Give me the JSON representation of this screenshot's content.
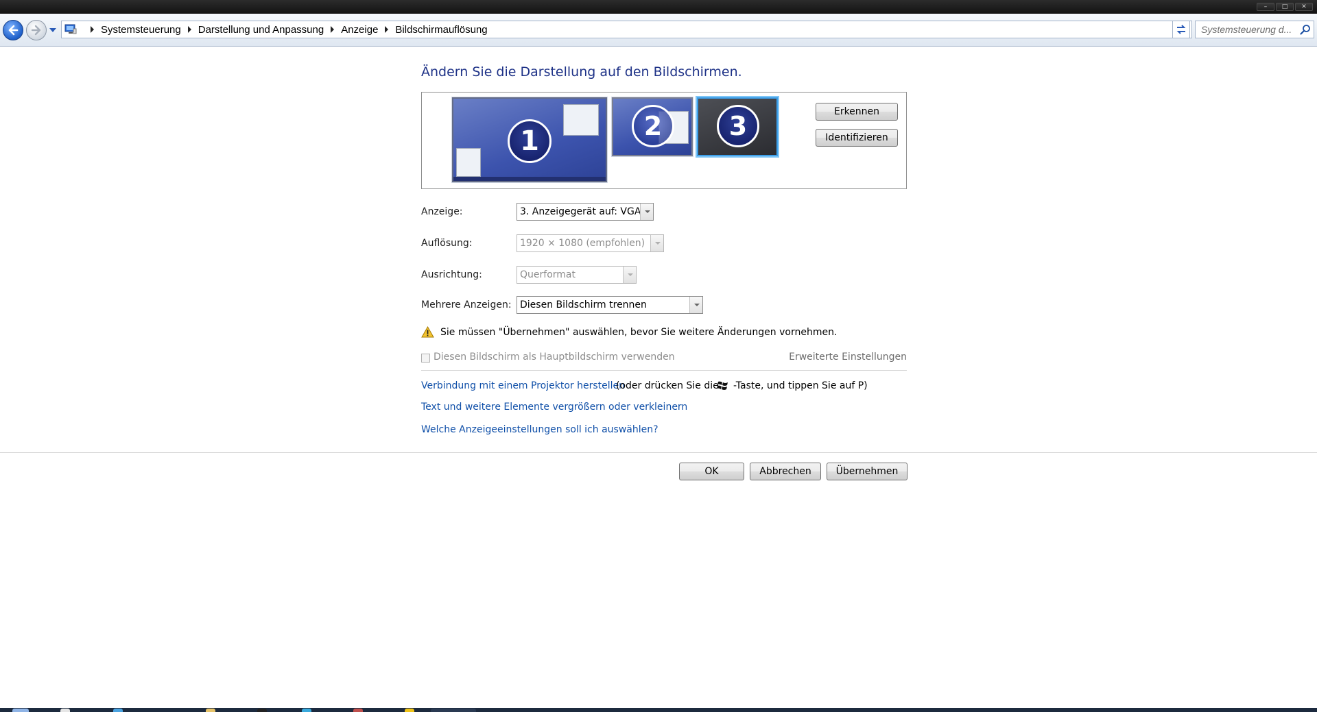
{
  "window": {
    "controls": {
      "minimize": "–",
      "maximize": "□",
      "close": "✕"
    }
  },
  "addressbar": {
    "breadcrumbs": [
      "Systemsteuerung",
      "Darstellung und Anpassung",
      "Anzeige",
      "Bildschirmauflösung"
    ],
    "search_placeholder": "Systemsteuerung d...",
    "icons": [
      "back-icon",
      "forward-icon",
      "recent-pages-icon",
      "control-panel-icon",
      "refresh-icon",
      "search-icon"
    ]
  },
  "main": {
    "heading": "Ändern Sie die Darstellung auf den Bildschirmen.",
    "monitors": [
      {
        "number": "1",
        "selected": false
      },
      {
        "number": "2",
        "selected": false
      },
      {
        "number": "3",
        "selected": true
      }
    ],
    "detect_button": "Erkennen",
    "identify_button": "Identifizieren",
    "fields": {
      "display_label": "Anzeige:",
      "display_value": "3. Anzeigegerät auf: VGA",
      "resolution_label": "Auflösung:",
      "resolution_value": "1920 × 1080 (empfohlen)",
      "orientation_label": "Ausrichtung:",
      "orientation_value": "Querformat",
      "multi_label": "Mehrere Anzeigen:",
      "multi_value": "Diesen Bildschirm trennen"
    },
    "warning": "Sie müssen \"Übernehmen\" auswählen, bevor Sie weitere Änderungen vornehmen.",
    "primary_checkbox_label": "Diesen Bildschirm als Hauptbildschirm verwenden",
    "primary_checkbox_checked": false,
    "advanced_link": "Erweiterte Einstellungen",
    "projector_link": "Verbindung mit einem Projektor herstellen",
    "projector_hint_pre": "(oder drücken Sie die",
    "projector_hint_post": "-Taste, und tippen Sie auf P)",
    "text_size_link": "Text und weitere Elemente vergrößern oder verkleinern",
    "help_link": "Welche Anzeigeeinstellungen soll ich auswählen?"
  },
  "footer": {
    "ok_button": "OK",
    "cancel_button": "Abbrechen",
    "apply_button": "Übernehmen"
  },
  "colors": {
    "heading": "#1e3287",
    "link": "#0f4fa8",
    "selected_monitor_border": "#3ea0ea",
    "disabled_text": "#8d8d8d"
  }
}
